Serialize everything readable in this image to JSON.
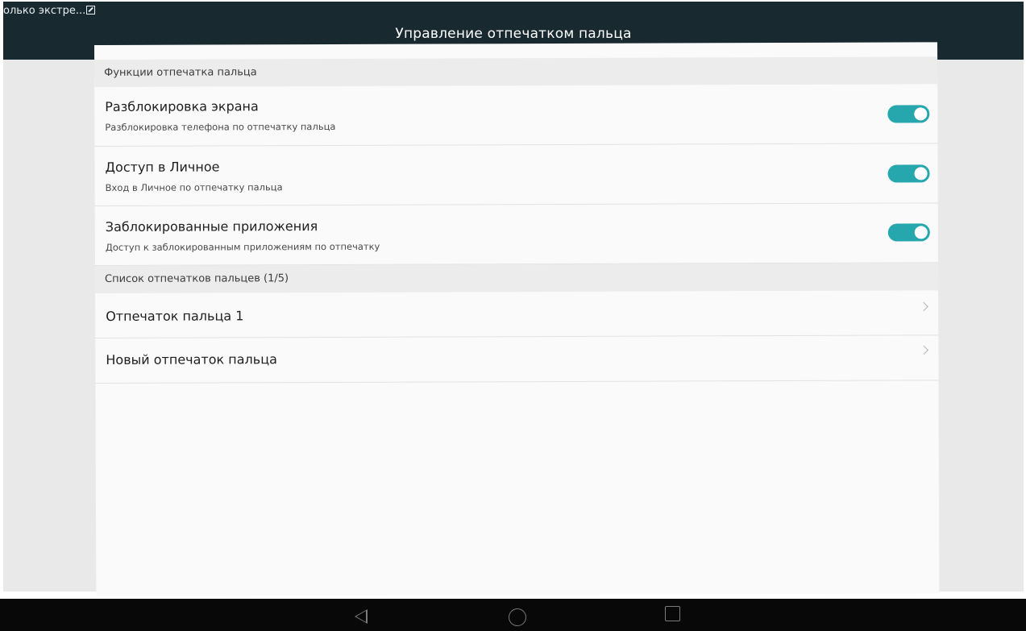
{
  "status_bar": {
    "notification_text": "олько экстре..."
  },
  "action_bar": {
    "title": "Управление отпечатком пальца"
  },
  "sections": {
    "features": {
      "header": "Функции отпечатка пальца",
      "items": [
        {
          "title": "Разблокировка экрана",
          "subtitle": "Разблокировка телефона по отпечатку пальца",
          "enabled": true
        },
        {
          "title": "Доступ в Личное",
          "subtitle": "Вход в Личное по отпечатку пальца",
          "enabled": true
        },
        {
          "title": "Заблокированные приложения",
          "subtitle": "Доступ к заблокированным приложениям по отпечатку",
          "enabled": true
        }
      ]
    },
    "fingerprints": {
      "header": "Список отпечатков пальцев (1/5)",
      "items": [
        {
          "title": "Отпечаток пальца 1"
        },
        {
          "title": "Новый отпечаток пальца"
        }
      ]
    }
  },
  "colors": {
    "action_bar": "#18292f",
    "toggle_on": "#26a7ad",
    "section_header": "#ececec",
    "nav_bar": "#080808"
  },
  "icons": {
    "status": "image-icon",
    "nav_back": "back-triangle-icon",
    "nav_home": "home-circle-icon",
    "nav_recent": "recent-apps-square-icon"
  }
}
